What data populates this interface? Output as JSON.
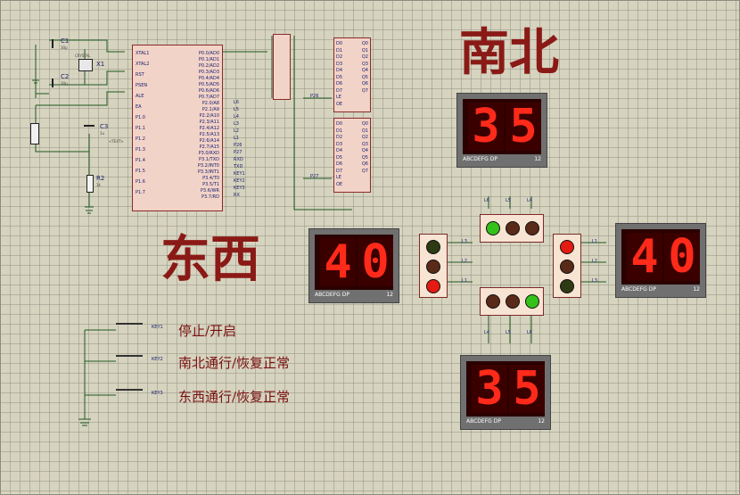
{
  "titles": {
    "north_south": "南北",
    "east_west": "东西"
  },
  "buttons": [
    {
      "label": "停止/开启",
      "ref": "KEY1"
    },
    {
      "label": "南北通行/恢复正常",
      "ref": "KEY2"
    },
    {
      "label": "东西通行/恢复正常",
      "ref": "KEY3"
    }
  ],
  "displays": {
    "north": {
      "tens": "3",
      "ones": "5",
      "segments": "ABCDEFG DP",
      "pins": "12"
    },
    "south": {
      "tens": "3",
      "ones": "5",
      "segments": "ABCDEFG DP",
      "pins": "12"
    },
    "west": {
      "tens": "4",
      "ones": "0",
      "segments": "ABCDEFG DP",
      "pins": "12"
    },
    "east": {
      "tens": "4",
      "ones": "0",
      "segments": "ABCDEFG DP",
      "pins": "12"
    }
  },
  "lights": {
    "north": {
      "lamps": [
        "green",
        "off-amber",
        "off-red"
      ],
      "labels": [
        "L6",
        "L5",
        "L4"
      ]
    },
    "south": {
      "lamps": [
        "off-red",
        "off-amber",
        "green"
      ],
      "labels": [
        "L4",
        "L5",
        "L6"
      ]
    },
    "west": {
      "lamps": [
        "off-green",
        "off-amber",
        "red"
      ],
      "labels": [
        "L3",
        "L2",
        "L1"
      ]
    },
    "east": {
      "lamps": [
        "red",
        "off-amber",
        "off-green"
      ],
      "labels": [
        "L1",
        "L2",
        "L3"
      ]
    }
  },
  "colors": {
    "lamp_red": "#e51a12",
    "lamp_green": "#34c11a",
    "lamp_off": "#5a2a18",
    "lamp_off_green": "#2e3a14",
    "title": "#8a1a16"
  },
  "components": {
    "c1": {
      "name": "C1",
      "value": "30p"
    },
    "c2": {
      "name": "C2",
      "value": "30p"
    },
    "c3": {
      "name": "C3",
      "value": "1u"
    },
    "r2": {
      "name": "R2",
      "value": "1k"
    },
    "x1": {
      "name": "X1",
      "value": "CRYSTAL"
    },
    "text_tag": "<TEXT>"
  },
  "mcu": {
    "left_pins": [
      "XTAL1",
      "XTAL2",
      "RST",
      "PSEN",
      "ALE",
      "EA",
      "P1.0",
      "P1.1",
      "P1.2",
      "P1.3",
      "P1.4",
      "P1.5",
      "P1.6",
      "P1.7"
    ],
    "right_pins": [
      "P0.0/AD0",
      "P0.1/AD1",
      "P0.2/AD2",
      "P0.3/AD3",
      "P0.4/AD4",
      "P0.5/AD5",
      "P0.6/AD6",
      "P0.7/AD7",
      "P2.0/A8",
      "P2.1/A9",
      "P2.2/A10",
      "P2.3/A11",
      "P2.4/A12",
      "P2.5/A13",
      "P2.6/A14",
      "P2.7/A15",
      "P3.0/RXD",
      "P3.1/TXD",
      "P3.2/INT0",
      "P3.3/INT1",
      "P3.4/T0",
      "P3.5/T1",
      "P3.6/WR",
      "P3.7/RD"
    ],
    "net_labels": [
      "L6",
      "L5",
      "L4",
      "L3",
      "L2",
      "L1",
      "P26",
      "P27",
      "RXD",
      "TXD",
      "KEY1",
      "KEY2",
      "KEY3",
      "RX"
    ]
  },
  "latches": {
    "upper_pins": [
      "D0",
      "D1",
      "D2",
      "D3",
      "D4",
      "D5",
      "D6",
      "D7",
      "LE",
      "OE"
    ],
    "upper_outputs": [
      "Q0",
      "Q1",
      "Q2",
      "Q3",
      "Q4",
      "Q5",
      "Q6",
      "Q7"
    ],
    "lower_pins": [
      "D0",
      "D1",
      "D2",
      "D3",
      "D4",
      "D5",
      "D6",
      "D7",
      "LE",
      "OE"
    ],
    "lower_outputs": [
      "Q0",
      "Q1",
      "Q2",
      "Q3",
      "Q4",
      "Q5",
      "Q6",
      "Q7"
    ],
    "le_labels": [
      "P26",
      "P27"
    ]
  }
}
